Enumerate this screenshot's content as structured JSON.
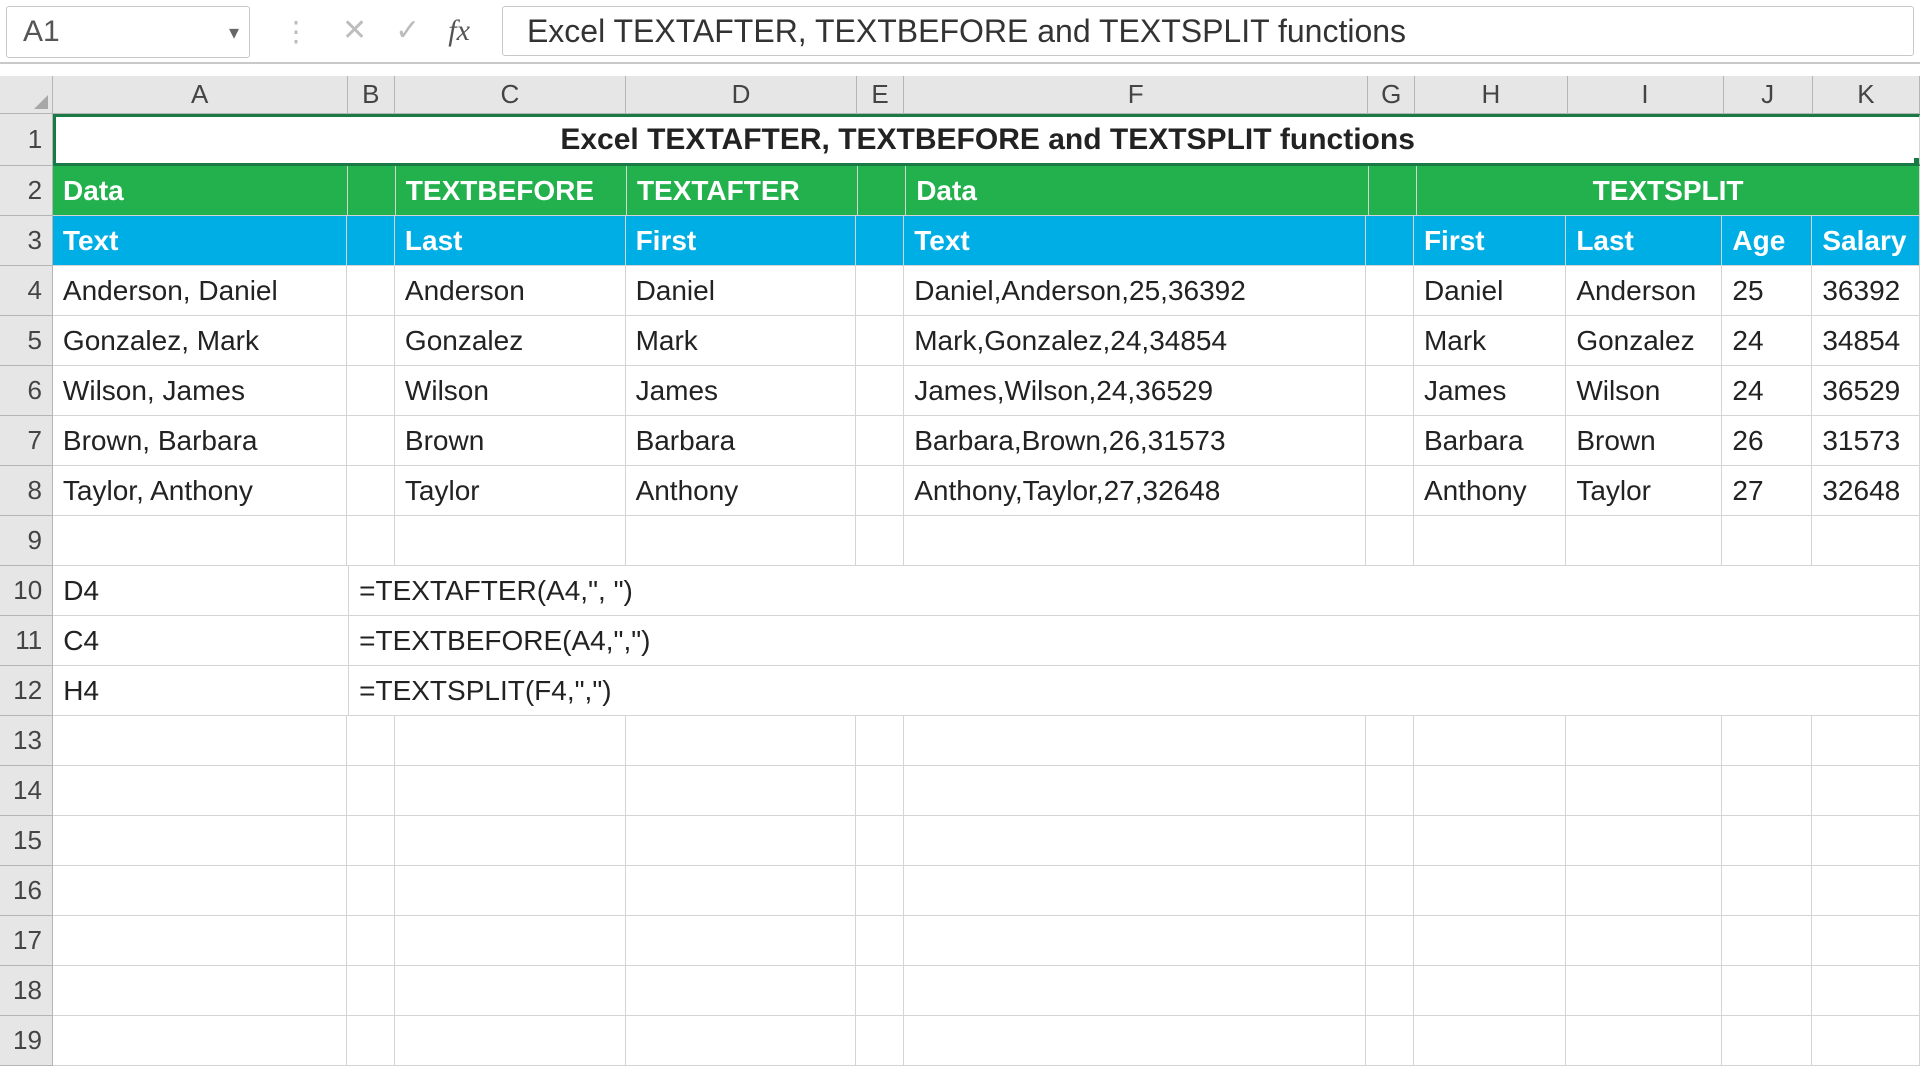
{
  "name_box": "A1",
  "formula_bar": "Excel TEXTAFTER, TEXTBEFORE and TEXTSPLIT functions",
  "columns": [
    "A",
    "B",
    "C",
    "D",
    "E",
    "F",
    "G",
    "H",
    "I",
    "J",
    "K"
  ],
  "title": "Excel TEXTAFTER, TEXTBEFORE and TEXTSPLIT functions",
  "row2": {
    "A": "Data",
    "C": "TEXTBEFORE",
    "D": "TEXTAFTER",
    "F": "Data",
    "HIJK": "TEXTSPLIT"
  },
  "row3": {
    "A": "Text",
    "C": "Last",
    "D": "First",
    "F": "Text",
    "H": "First",
    "I": "Last",
    "J": "Age",
    "K": "Salary"
  },
  "data_rows": [
    {
      "A": "Anderson, Daniel",
      "C": "Anderson",
      "D": "Daniel",
      "F": "Daniel,Anderson,25,36392",
      "H": "Daniel",
      "I": "Anderson",
      "J": "25",
      "K": "36392"
    },
    {
      "A": "Gonzalez, Mark",
      "C": "Gonzalez",
      "D": "Mark",
      "F": "Mark,Gonzalez,24,34854",
      "H": "Mark",
      "I": "Gonzalez",
      "J": "24",
      "K": "34854"
    },
    {
      "A": "Wilson, James",
      "C": "Wilson",
      "D": "James",
      "F": "James,Wilson,24,36529",
      "H": "James",
      "I": "Wilson",
      "J": "24",
      "K": "36529"
    },
    {
      "A": "Brown, Barbara",
      "C": "Brown",
      "D": "Barbara",
      "F": "Barbara,Brown,26,31573",
      "H": "Barbara",
      "I": "Brown",
      "J": "26",
      "K": "31573"
    },
    {
      "A": "Taylor, Anthony",
      "C": "Taylor",
      "D": "Anthony",
      "F": "Anthony,Taylor,27,32648",
      "H": "Anthony",
      "I": "Taylor",
      "J": "27",
      "K": "32648"
    }
  ],
  "formula_rows": [
    {
      "A": "D4",
      "formula": "=TEXTAFTER(A4,\", \")"
    },
    {
      "A": "C4",
      "formula": "=TEXTBEFORE(A4,\",\")"
    },
    {
      "A": "H4",
      "formula": "=TEXTSPLIT(F4,\",\")"
    }
  ]
}
